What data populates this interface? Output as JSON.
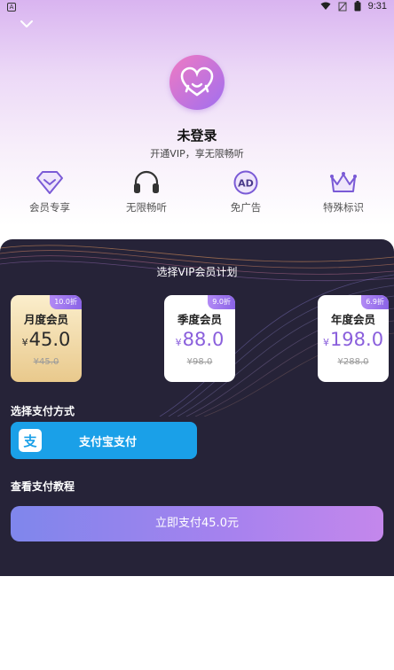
{
  "status": {
    "time": "9:31",
    "app_icon_glyph": "A"
  },
  "profile": {
    "title": "未登录",
    "subtitle": "开通VIP，享无限畅听"
  },
  "perks": [
    {
      "label": "会员专享",
      "icon": "diamond-icon"
    },
    {
      "label": "无限畅听",
      "icon": "headphones-icon"
    },
    {
      "label": "免广告",
      "icon": "ad-icon",
      "glyph": "AD"
    },
    {
      "label": "特殊标识",
      "icon": "crown-icon"
    }
  ],
  "plans_title": "选择VIP会员计划",
  "plans": [
    {
      "name": "月度会员",
      "badge": "10.0折",
      "currency": "¥",
      "price": "45.0",
      "old_price": "¥45.0",
      "selected": true
    },
    {
      "name": "季度会员",
      "badge": "9.0折",
      "currency": "¥",
      "price": "88.0",
      "old_price": "¥98.0",
      "selected": false
    },
    {
      "name": "年度会员",
      "badge": "6.9折",
      "currency": "¥",
      "price": "198.0",
      "old_price": "¥288.0",
      "selected": false
    }
  ],
  "payment": {
    "title": "选择支付方式",
    "method_label": "支付宝支付",
    "method_icon_glyph": "支",
    "tutorial": "查看支付教程",
    "submit": "立即支付45.0元"
  },
  "colors": {
    "accent": "#8a5fdc",
    "alipay": "#1aa0e8",
    "panel": "#262338",
    "selected_plan": "#e9c98c"
  }
}
